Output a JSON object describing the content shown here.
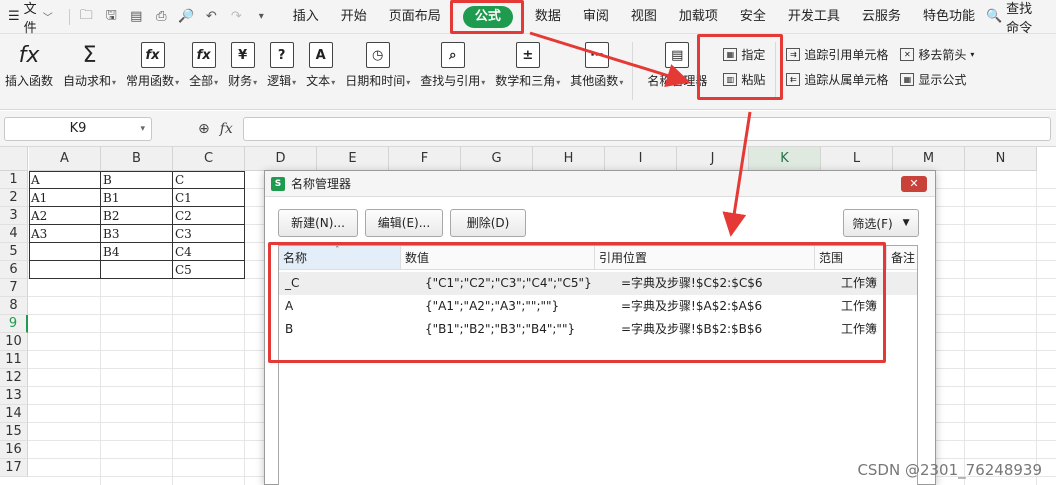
{
  "menubar": {
    "file_label": "文件",
    "tabs": [
      "插入",
      "开始",
      "页面布局",
      "公式",
      "数据",
      "审阅",
      "视图",
      "加载项",
      "安全",
      "开发工具",
      "云服务",
      "特色功能"
    ],
    "active_tab": "公式",
    "search_label": "查找命令"
  },
  "ribbon": {
    "buttons": [
      {
        "label": "插入函数",
        "icon": "fx"
      },
      {
        "label": "自动求和",
        "icon": "Σ"
      },
      {
        "label": "常用函数",
        "icon": "fx"
      },
      {
        "label": "全部",
        "icon": "fx"
      },
      {
        "label": "财务",
        "icon": "¥"
      },
      {
        "label": "逻辑",
        "icon": "?"
      },
      {
        "label": "文本",
        "icon": "A"
      },
      {
        "label": "日期和时间",
        "icon": "◷"
      },
      {
        "label": "查找与引用",
        "icon": "🔍"
      },
      {
        "label": "数学和三角",
        "icon": "+"
      },
      {
        "label": "其他函数",
        "icon": "…"
      },
      {
        "label": "名称管理器",
        "icon": "▤"
      }
    ],
    "small_a": [
      "指定",
      "粘贴"
    ],
    "small_b": [
      "追踪引用单元格",
      "追踪从属单元格"
    ],
    "small_c": [
      "移去箭头",
      "显示公式"
    ]
  },
  "formula_bar": {
    "name_box": "K9",
    "fx_label": "fx",
    "formula_value": ""
  },
  "grid": {
    "columns": [
      "A",
      "B",
      "C",
      "D",
      "E",
      "F",
      "G",
      "H",
      "I",
      "J",
      "K",
      "L",
      "M",
      "N"
    ],
    "rows": [
      "1",
      "2",
      "3",
      "4",
      "5",
      "6",
      "7",
      "8",
      "9",
      "10",
      "11",
      "12",
      "13",
      "14",
      "15",
      "16",
      "17"
    ],
    "selected_column": "K",
    "selected_row": "9",
    "cells": {
      "col_a": [
        "A",
        "A1",
        "A2",
        "A3",
        "",
        ""
      ],
      "col_b": [
        "B",
        "B1",
        "B2",
        "B3",
        "B4",
        ""
      ],
      "col_c": [
        "C",
        "C1",
        "C2",
        "C3",
        "C4",
        "C5"
      ]
    }
  },
  "dialog": {
    "title": "名称管理器",
    "logo": "S",
    "close": "✕",
    "new_button": "新建(N)...",
    "edit_button": "编辑(E)...",
    "delete_button": "删除(D)",
    "filter_button": "筛选(F)",
    "headers": [
      "名称",
      "数值",
      "引用位置",
      "范围",
      "备注"
    ],
    "rows": [
      {
        "name": "_C",
        "value": "{\"C1\";\"C2\";\"C3\";\"C4\";\"C5\"}",
        "ref": "=字典及步骤!$C$2:$C$6",
        "scope": "工作簿",
        "note": ""
      },
      {
        "name": "A",
        "value": "{\"A1\";\"A2\";\"A3\";\"\";\"\"}",
        "ref": "=字典及步骤!$A$2:$A$6",
        "scope": "工作簿",
        "note": ""
      },
      {
        "name": "B",
        "value": "{\"B1\";\"B2\";\"B3\";\"B4\";\"\"}",
        "ref": "=字典及步骤!$B$2:$B$6",
        "scope": "工作簿",
        "note": ""
      }
    ]
  },
  "watermark": "CSDN @2301_76248939",
  "colors": {
    "accent_green": "#1e9b4e",
    "highlight_red": "#e53935"
  }
}
